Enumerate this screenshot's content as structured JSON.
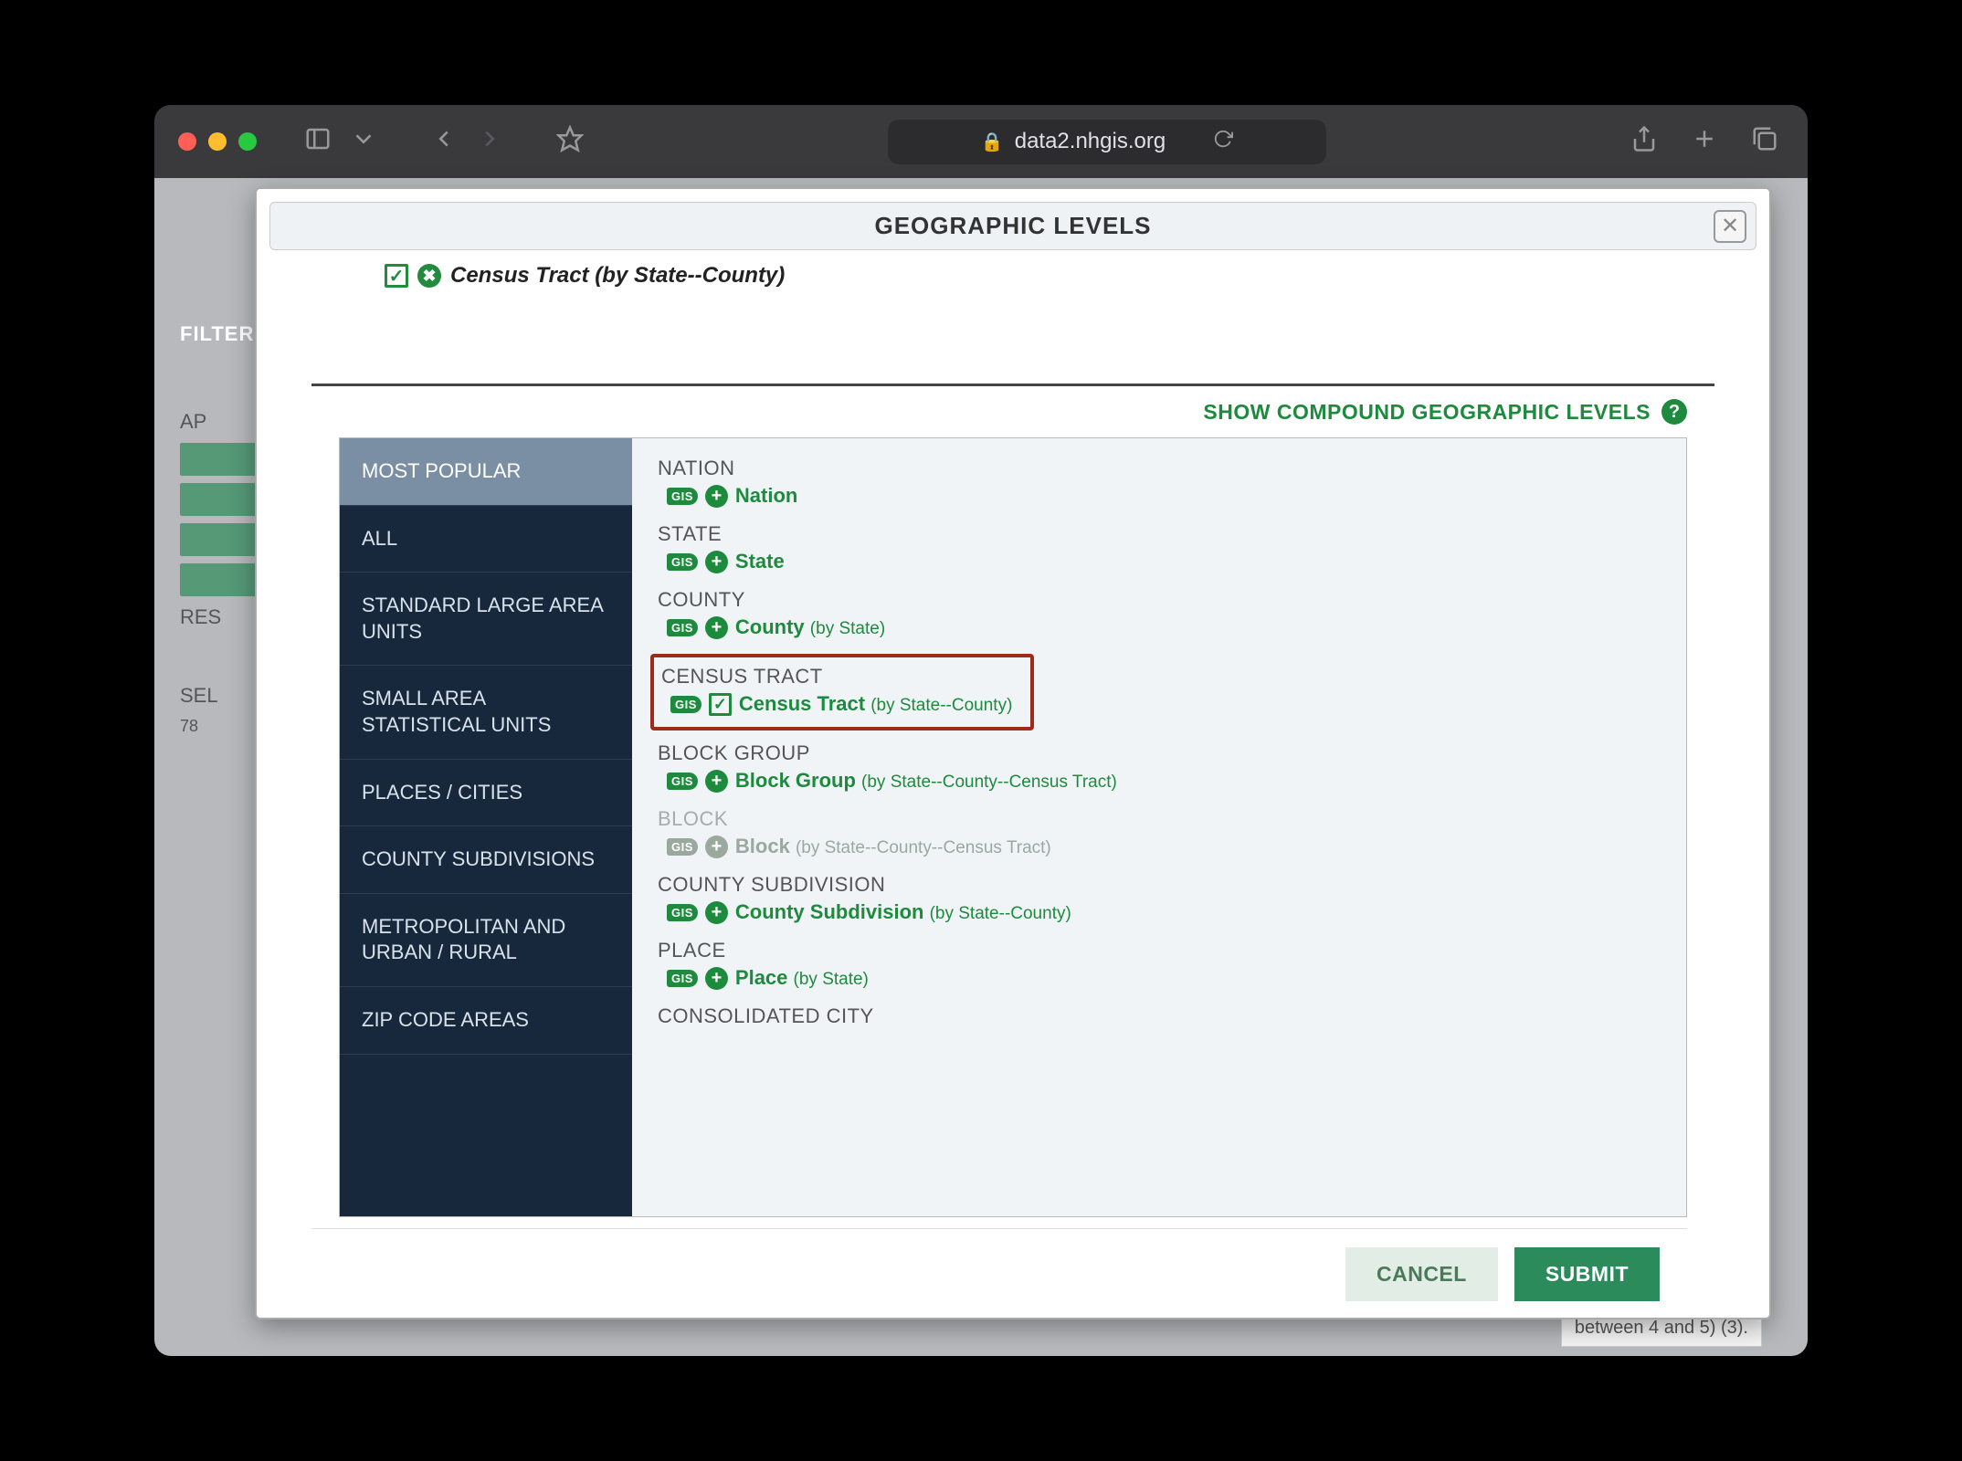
{
  "browser": {
    "url": "data2.nhgis.org"
  },
  "background": {
    "filter_label": "FILTER",
    "apply_label": "AP",
    "results_label": "RES",
    "select_label": "SEL",
    "count": "78",
    "bottom_box": "between 4 and 5) (3)."
  },
  "modal": {
    "title": "GEOGRAPHIC LEVELS",
    "selected": "Census Tract (by State--County)",
    "compound_link": "SHOW COMPOUND GEOGRAPHIC LEVELS",
    "categories": [
      "MOST POPULAR",
      "ALL",
      "STANDARD LARGE AREA UNITS",
      "SMALL AREA STATISTICAL UNITS",
      "PLACES / CITIES",
      "COUNTY SUBDIVISIONS",
      "METROPOLITAN AND URBAN / RURAL",
      "ZIP CODE AREAS"
    ],
    "geo_groups": [
      {
        "head": "NATION",
        "name": "Nation",
        "sub": "",
        "disabled": false,
        "selected": false
      },
      {
        "head": "STATE",
        "name": "State",
        "sub": "",
        "disabled": false,
        "selected": false
      },
      {
        "head": "COUNTY",
        "name": "County",
        "sub": "(by State)",
        "disabled": false,
        "selected": false
      },
      {
        "head": "CENSUS TRACT",
        "name": "Census Tract",
        "sub": "(by State--County)",
        "disabled": false,
        "selected": true,
        "highlight": true
      },
      {
        "head": "BLOCK GROUP",
        "name": "Block Group",
        "sub": "(by State--County--Census Tract)",
        "disabled": false,
        "selected": false
      },
      {
        "head": "BLOCK",
        "name": "Block",
        "sub": "(by State--County--Census Tract)",
        "disabled": true,
        "selected": false
      },
      {
        "head": "COUNTY SUBDIVISION",
        "name": "County Subdivision",
        "sub": "(by State--County)",
        "disabled": false,
        "selected": false
      },
      {
        "head": "PLACE",
        "name": "Place",
        "sub": "(by State)",
        "disabled": false,
        "selected": false
      },
      {
        "head": "CONSOLIDATED CITY",
        "name": "",
        "sub": "",
        "disabled": false,
        "selected": false,
        "partial": true
      }
    ],
    "cancel": "CANCEL",
    "submit": "SUBMIT"
  }
}
